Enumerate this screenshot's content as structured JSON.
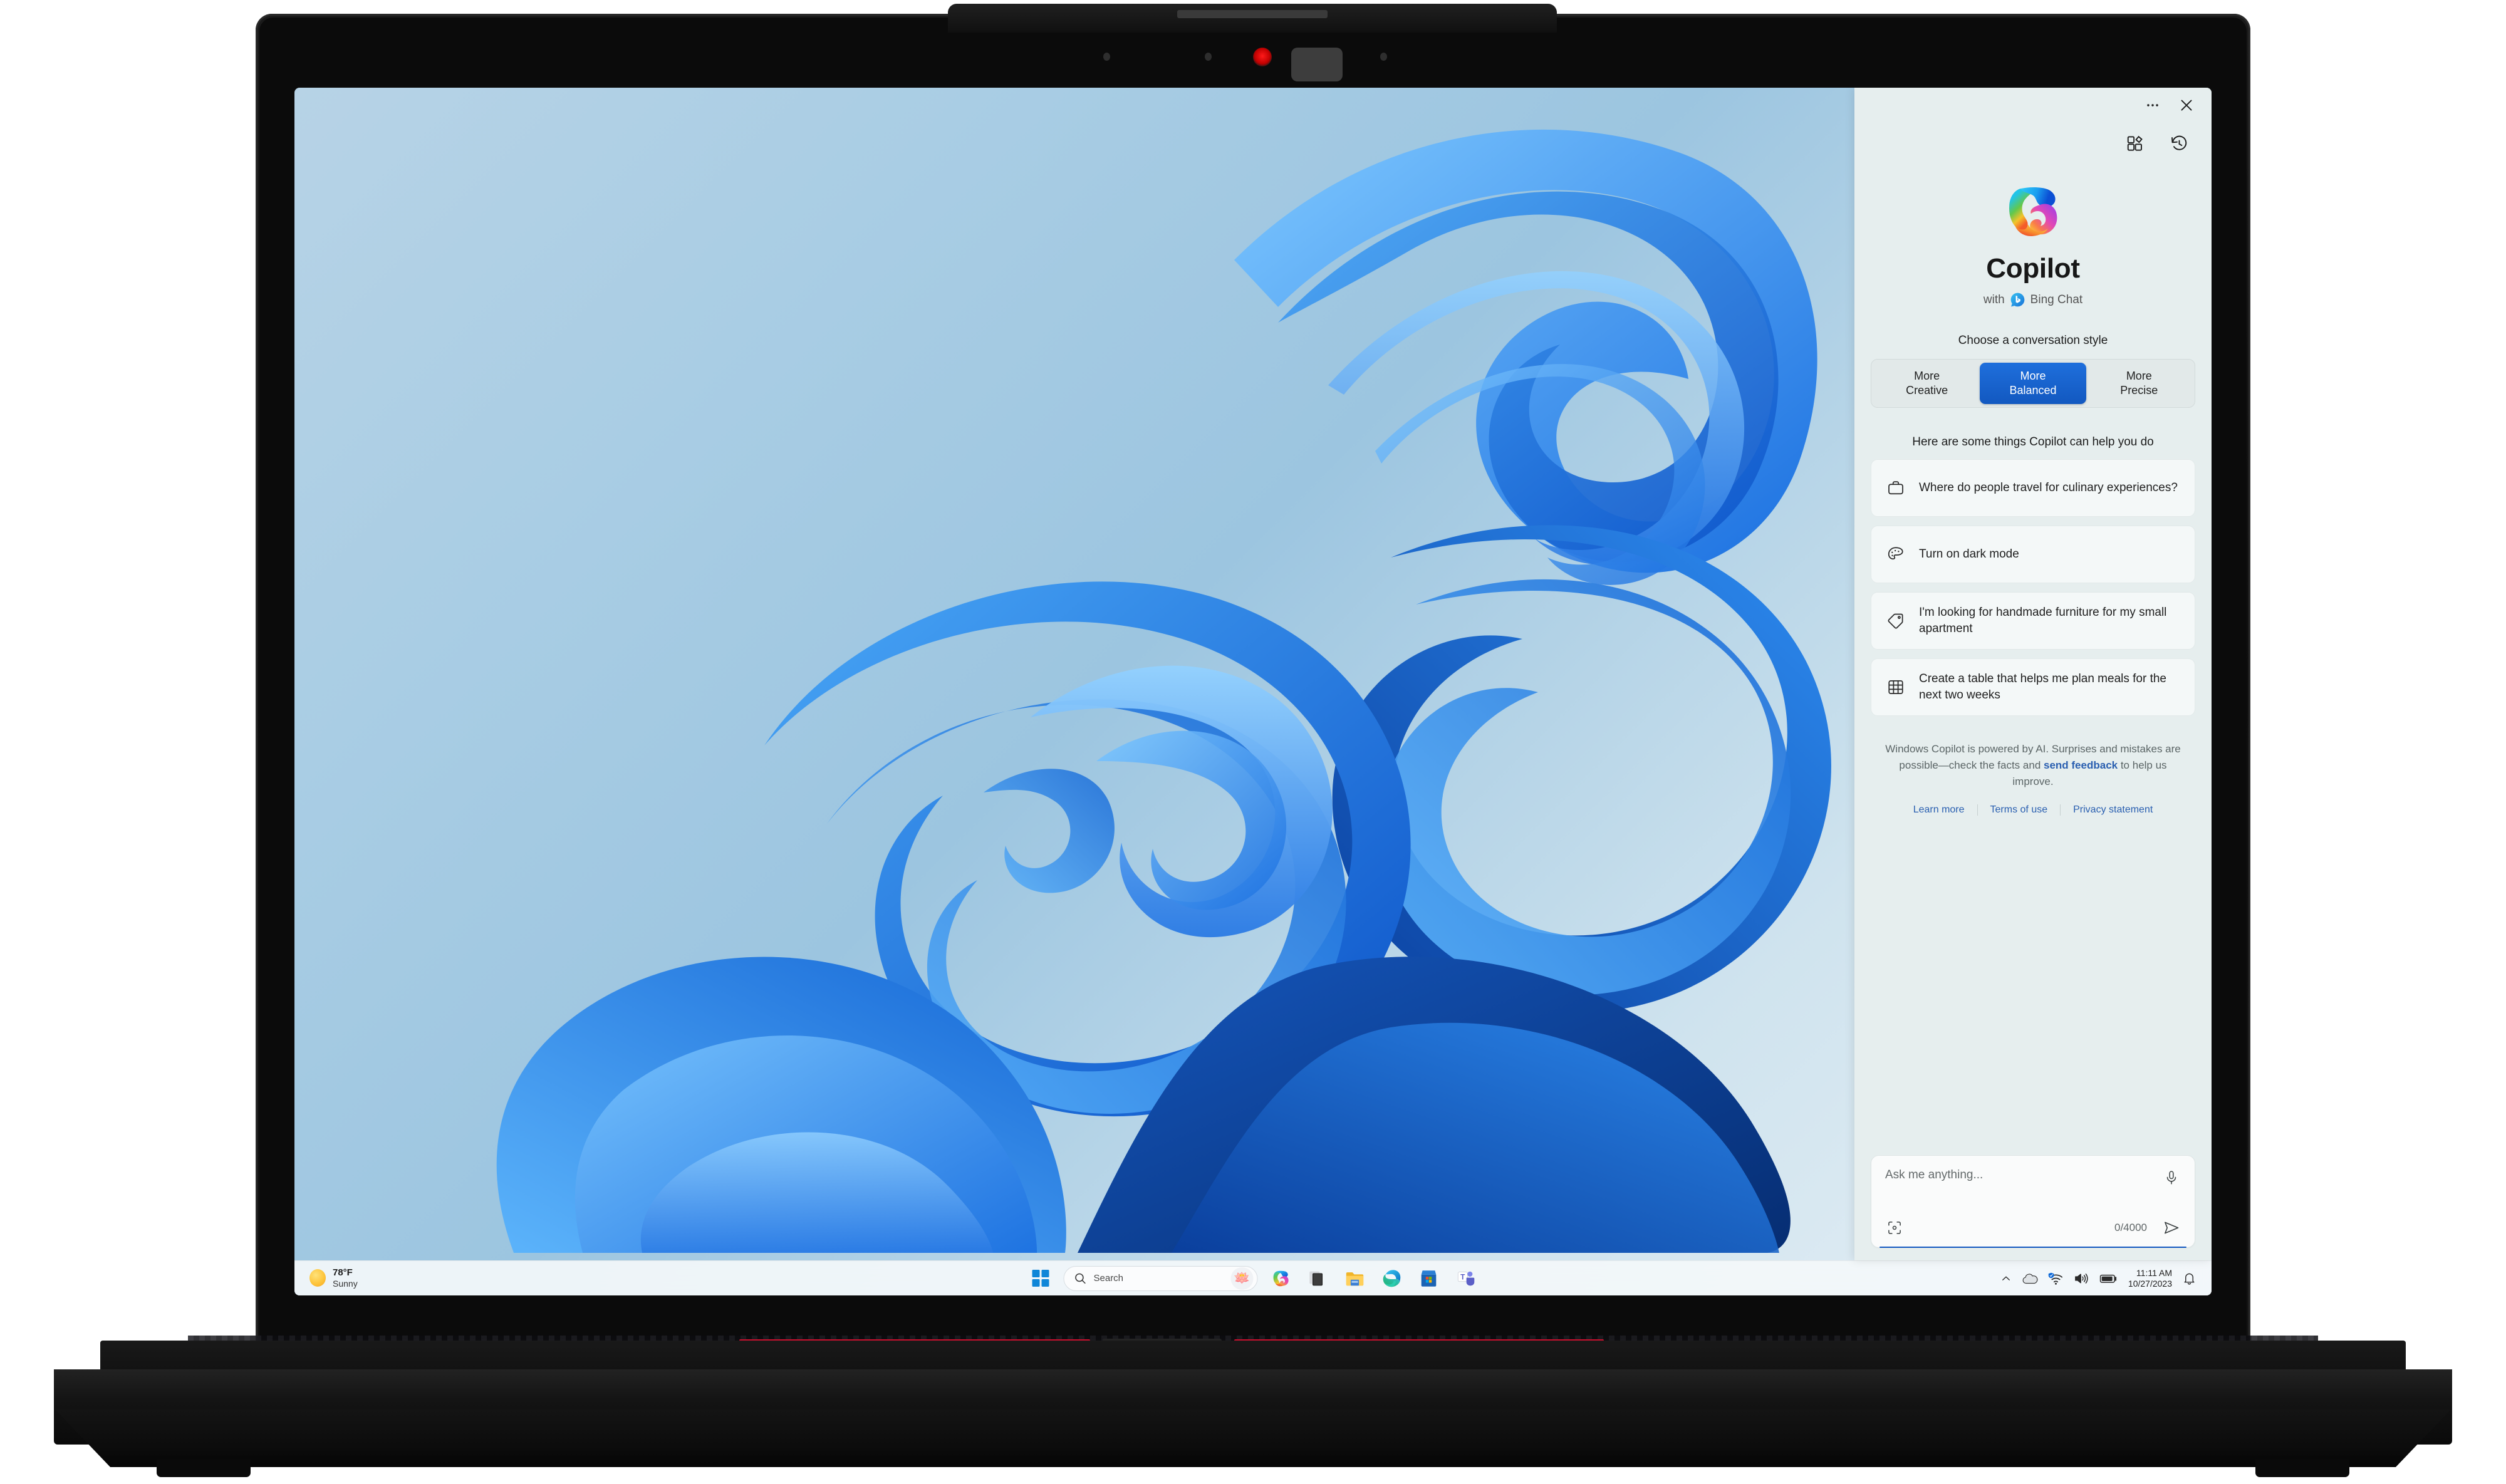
{
  "device": {
    "type": "laptop",
    "brand_accent_color": "#c8102e",
    "camera_led_color": "#ff1a1a"
  },
  "desktop": {
    "wallpaper_name": "windows-11-bloom-wallpaper",
    "wallpaper_colors": [
      "#b7d3e6",
      "#1a6fe0",
      "#2d8ef0",
      "#0c4bb5",
      "#5fb2f8"
    ]
  },
  "taskbar": {
    "weather": {
      "temperature": "78°F",
      "condition": "Sunny",
      "icon": "sun-icon"
    },
    "start_button_label": "Start",
    "search": {
      "placeholder": "Search",
      "icon": "search-icon",
      "badge_icon": "lotus-icon"
    },
    "apps": [
      {
        "name": "copilot-taskbar-icon",
        "label": "Copilot"
      },
      {
        "name": "task-view-icon",
        "label": "Task View"
      },
      {
        "name": "file-explorer-icon",
        "label": "File Explorer"
      },
      {
        "name": "edge-icon",
        "label": "Microsoft Edge"
      },
      {
        "name": "microsoft-store-icon",
        "label": "Microsoft Store"
      },
      {
        "name": "teams-icon",
        "label": "Microsoft Teams"
      }
    ],
    "tray": {
      "overflow_icon": "chevron-up-icon",
      "onedrive_icon": "cloud-icon",
      "network_icon": "wifi-icon",
      "volume_icon": "speaker-icon",
      "battery_icon": "battery-icon",
      "notification_icon": "bell-icon",
      "time": "11:11 AM",
      "date": "10/27/2023"
    }
  },
  "copilot": {
    "titlebar": {
      "more_label": "•••",
      "more_icon": "more-options-icon",
      "close_label": "✕",
      "close_icon": "close-icon"
    },
    "tools": {
      "plugins_icon": "plugins-icon",
      "history_icon": "history-icon"
    },
    "brand": {
      "logo_icon": "copilot-logo-icon",
      "title": "Copilot",
      "subtitle_prefix": "with",
      "subtitle_icon": "bing-icon",
      "subtitle_suffix": "Bing Chat"
    },
    "conversation_style": {
      "heading": "Choose a conversation style",
      "options": [
        {
          "line1": "More",
          "line2": "Creative",
          "selected": false
        },
        {
          "line1": "More",
          "line2": "Balanced",
          "selected": true
        },
        {
          "line1": "More",
          "line2": "Precise",
          "selected": false
        }
      ],
      "selected_color": "#1258c0"
    },
    "suggestions": {
      "heading": "Here are some things Copilot can help you do",
      "cards": [
        {
          "icon": "briefcase-icon",
          "text": "Where do people travel for culinary experiences?"
        },
        {
          "icon": "palette-icon",
          "text": "Turn on dark mode"
        },
        {
          "icon": "tag-icon",
          "text": "I'm looking for handmade furniture for my small apartment"
        },
        {
          "icon": "table-grid-icon",
          "text": "Create a table that helps me plan meals for the next two weeks"
        }
      ]
    },
    "disclaimer": {
      "part1": "Windows Copilot is powered by AI. Surprises and mistakes are possible—check the facts and ",
      "link": "send feedback",
      "part2": " to help us improve."
    },
    "links": [
      {
        "label": "Learn more"
      },
      {
        "label": "Terms of use"
      },
      {
        "label": "Privacy statement"
      }
    ],
    "composer": {
      "placeholder": "Ask me anything...",
      "value": "",
      "mic_icon": "microphone-icon",
      "visual_search_icon": "visual-search-icon",
      "send_icon": "send-icon",
      "counter": "0/4000",
      "accent_color": "#1258c0"
    }
  }
}
